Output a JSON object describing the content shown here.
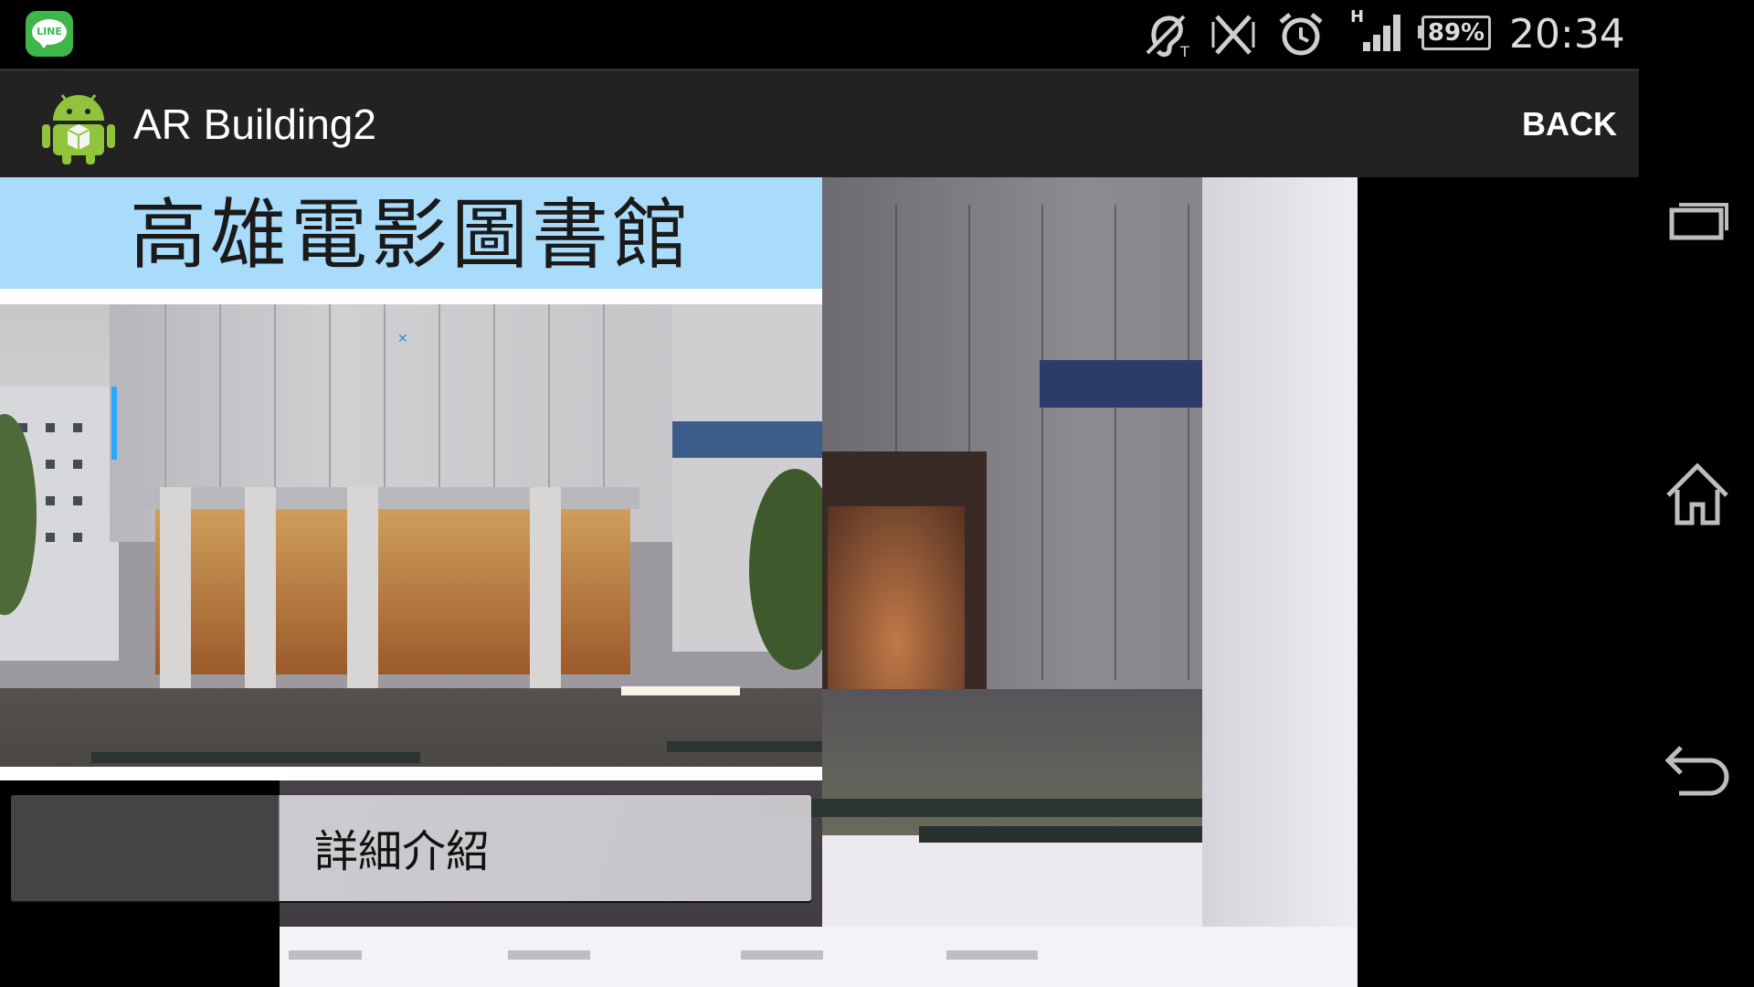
{
  "status_bar": {
    "time": "20:34",
    "battery": "89%",
    "network_type": "H",
    "icons": [
      "line-icon",
      "hearing-aid-icon",
      "vibrate-off-icon",
      "alarm-icon",
      "signal-icon",
      "battery-icon"
    ]
  },
  "app": {
    "title": "AR Building2",
    "back_label": "BACK",
    "icon": "android-app-icon"
  },
  "info_panel": {
    "heading": "高雄電影圖書館",
    "photo": "building-photo",
    "button_label": "詳細介紹"
  },
  "nav_bar": {
    "icons": [
      "recent-apps-icon",
      "home-icon",
      "back-arrow-icon"
    ]
  },
  "colors": {
    "title_band": "#a9dcfb",
    "action_bar": "#222222",
    "status_bar": "#000000",
    "line_green": "#3fb64a"
  }
}
